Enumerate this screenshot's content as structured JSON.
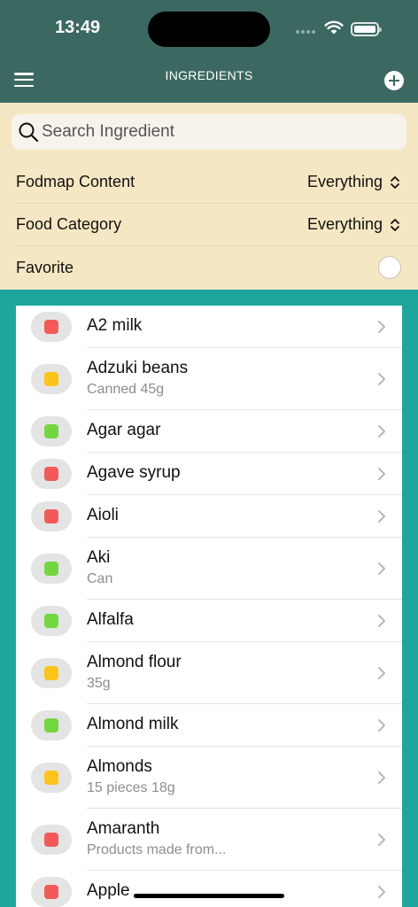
{
  "status": {
    "time": "13:49"
  },
  "header": {
    "title": "INGREDIENTS"
  },
  "search": {
    "placeholder": "Search Ingredient"
  },
  "filters": {
    "fodmap_label": "Fodmap Content",
    "fodmap_value": "Everything",
    "category_label": "Food Category",
    "category_value": "Everything",
    "favorite_label": "Favorite",
    "favorite_on": false
  },
  "colors": {
    "header": "#3b6962",
    "filters_bg": "#f6e7c4",
    "list_bg": "#1ea69c",
    "red": "#f25a5a",
    "yellow": "#fcc41a",
    "green": "#73d742"
  },
  "ingredients": [
    {
      "name": "A2 milk",
      "detail": "",
      "level": "red"
    },
    {
      "name": "Adzuki beans",
      "detail": "Canned 45g",
      "level": "yellow"
    },
    {
      "name": "Agar agar",
      "detail": "",
      "level": "green"
    },
    {
      "name": "Agave syrup",
      "detail": "",
      "level": "red"
    },
    {
      "name": "Aioli",
      "detail": "",
      "level": "red"
    },
    {
      "name": "Aki",
      "detail": "Can",
      "level": "green"
    },
    {
      "name": "Alfalfa",
      "detail": "",
      "level": "green"
    },
    {
      "name": "Almond flour",
      "detail": "35g",
      "level": "yellow"
    },
    {
      "name": "Almond milk",
      "detail": "",
      "level": "green"
    },
    {
      "name": "Almonds",
      "detail": "15 pieces 18g",
      "level": "yellow"
    },
    {
      "name": "Amaranth",
      "detail": "Products made from...",
      "level": "red"
    },
    {
      "name": "Apple",
      "detail": "",
      "level": "red"
    }
  ]
}
